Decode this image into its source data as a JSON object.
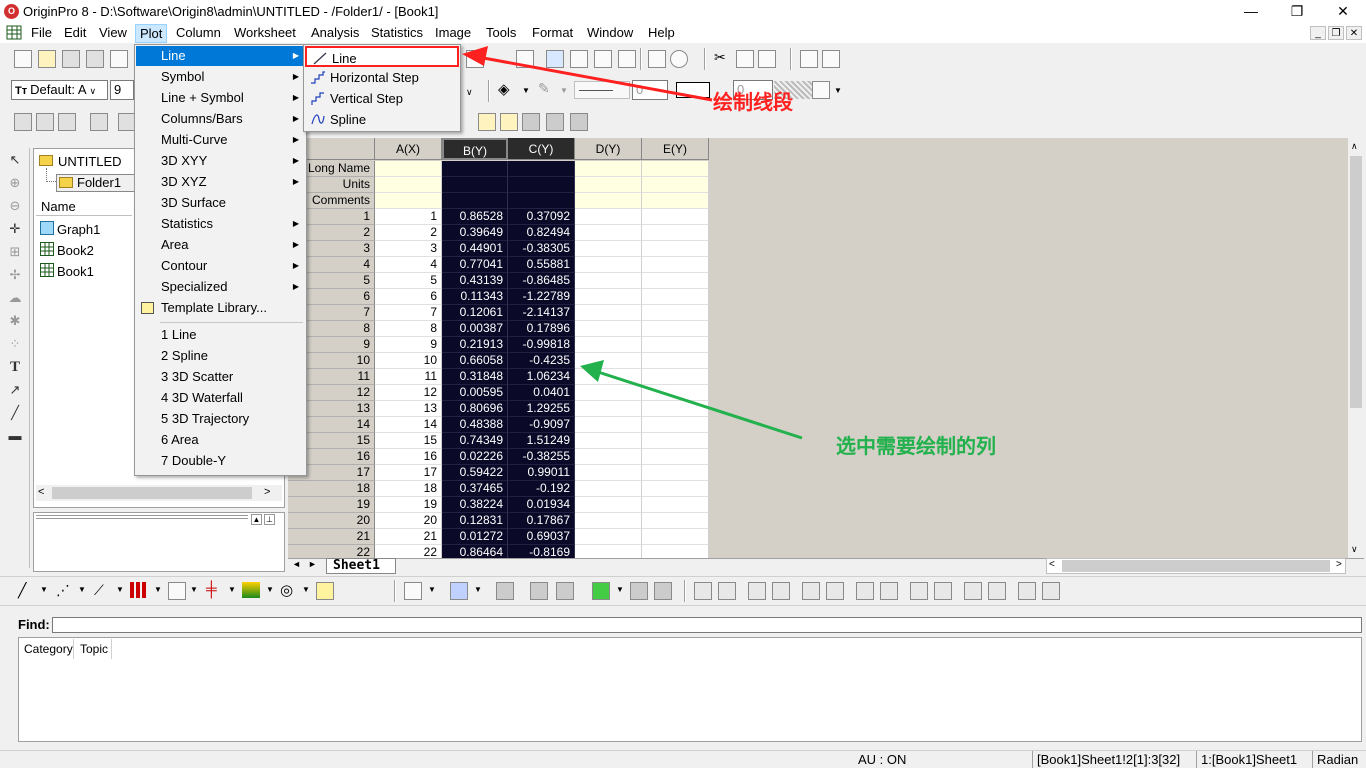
{
  "window": {
    "app_icon": "origin-logo-icon",
    "title": "OriginPro 8 - D:\\Software\\Origin8\\admin\\UNTITLED - /Folder1/ - [Book1]",
    "controls": [
      "—",
      "❐",
      "✕"
    ]
  },
  "menubar": {
    "items": [
      "File",
      "Edit",
      "View",
      "Plot",
      "Column",
      "Worksheet",
      "Analysis",
      "Statistics",
      "Image",
      "Tools",
      "Format",
      "Window",
      "Help"
    ],
    "active": "Plot"
  },
  "toolbar": {
    "font_combo": "Default: A",
    "size_combo": "9",
    "zero_combo_1": "0",
    "zero_combo_2": "0"
  },
  "plot_menu": {
    "items": [
      {
        "label": "Line",
        "submenu": true
      },
      {
        "label": "Symbol",
        "submenu": true
      },
      {
        "label": "Line + Symbol",
        "submenu": true
      },
      {
        "label": "Columns/Bars",
        "submenu": true
      },
      {
        "label": "Multi-Curve",
        "submenu": true
      },
      {
        "label": "3D XYY",
        "submenu": true
      },
      {
        "label": "3D XYZ",
        "submenu": true
      },
      {
        "label": "3D Surface",
        "submenu": false
      },
      {
        "label": "Statistics",
        "submenu": true
      },
      {
        "label": "Area",
        "submenu": true
      },
      {
        "label": "Contour",
        "submenu": true
      },
      {
        "label": "Specialized",
        "submenu": true
      },
      {
        "label": "Template Library...",
        "submenu": false
      }
    ],
    "recent": [
      "1 Line",
      "2 Spline",
      "3 3D Scatter",
      "4 3D Waterfall",
      "5 3D Trajectory",
      "6 Area",
      "7 Double-Y"
    ]
  },
  "line_submenu": {
    "items": [
      "Line",
      "Horizontal Step",
      "Vertical Step",
      "Spline"
    ]
  },
  "explorer": {
    "root": "UNTITLED",
    "folder": "Folder1",
    "column_header": "Name",
    "items": [
      "Graph1",
      "Book2",
      "Book1"
    ]
  },
  "worksheet": {
    "columns": [
      "A(X)",
      "B(Y)",
      "C(Y)",
      "D(Y)",
      "E(Y)"
    ],
    "meta_rows": [
      "Long Name",
      "Units",
      "Comments"
    ],
    "rows": [
      [
        "1",
        "1",
        "0.86528",
        "0.37092"
      ],
      [
        "2",
        "2",
        "0.39649",
        "0.82494"
      ],
      [
        "3",
        "3",
        "0.44901",
        "-0.38305"
      ],
      [
        "4",
        "4",
        "0.77041",
        "0.55881"
      ],
      [
        "5",
        "5",
        "0.43139",
        "-0.86485"
      ],
      [
        "6",
        "6",
        "0.11343",
        "-1.22789"
      ],
      [
        "7",
        "7",
        "0.12061",
        "-2.14137"
      ],
      [
        "8",
        "8",
        "0.00387",
        "0.17896"
      ],
      [
        "9",
        "9",
        "0.21913",
        "-0.99818"
      ],
      [
        "10",
        "10",
        "0.66058",
        "-0.4235"
      ],
      [
        "11",
        "11",
        "0.31848",
        "1.06234"
      ],
      [
        "12",
        "12",
        "0.00595",
        "0.0401"
      ],
      [
        "13",
        "13",
        "0.80696",
        "1.29255"
      ],
      [
        "14",
        "14",
        "0.48388",
        "-0.9097"
      ],
      [
        "15",
        "15",
        "0.74349",
        "1.51249"
      ],
      [
        "16",
        "16",
        "0.02226",
        "-0.38255"
      ],
      [
        "17",
        "17",
        "0.59422",
        "0.99011"
      ],
      [
        "18",
        "18",
        "0.37465",
        "-0.192"
      ],
      [
        "19",
        "19",
        "0.38224",
        "0.01934"
      ],
      [
        "20",
        "20",
        "0.12831",
        "0.17867"
      ],
      [
        "21",
        "21",
        "0.01272",
        "0.69037"
      ],
      [
        "22",
        "22",
        "0.86464",
        "-0.8169"
      ]
    ],
    "sheet_tab": "Sheet1"
  },
  "annotations": {
    "line_note": "绘制线段",
    "select_note": "选中需要绘制的列",
    "red": "#ff2020",
    "green": "#22b14c"
  },
  "find": {
    "label": "Find:",
    "result_columns": [
      "Category",
      "Topic"
    ]
  },
  "statusbar": {
    "au": "AU : ON",
    "cell": "[Book1]Sheet1!2[1]:3[32]",
    "layer": "1:[Book1]Sheet1",
    "unit": "Radian"
  },
  "colors": {
    "menu_highlight": "#0078d7",
    "selected_column": "#0a0a28",
    "meta_row": "#ffffe1"
  }
}
